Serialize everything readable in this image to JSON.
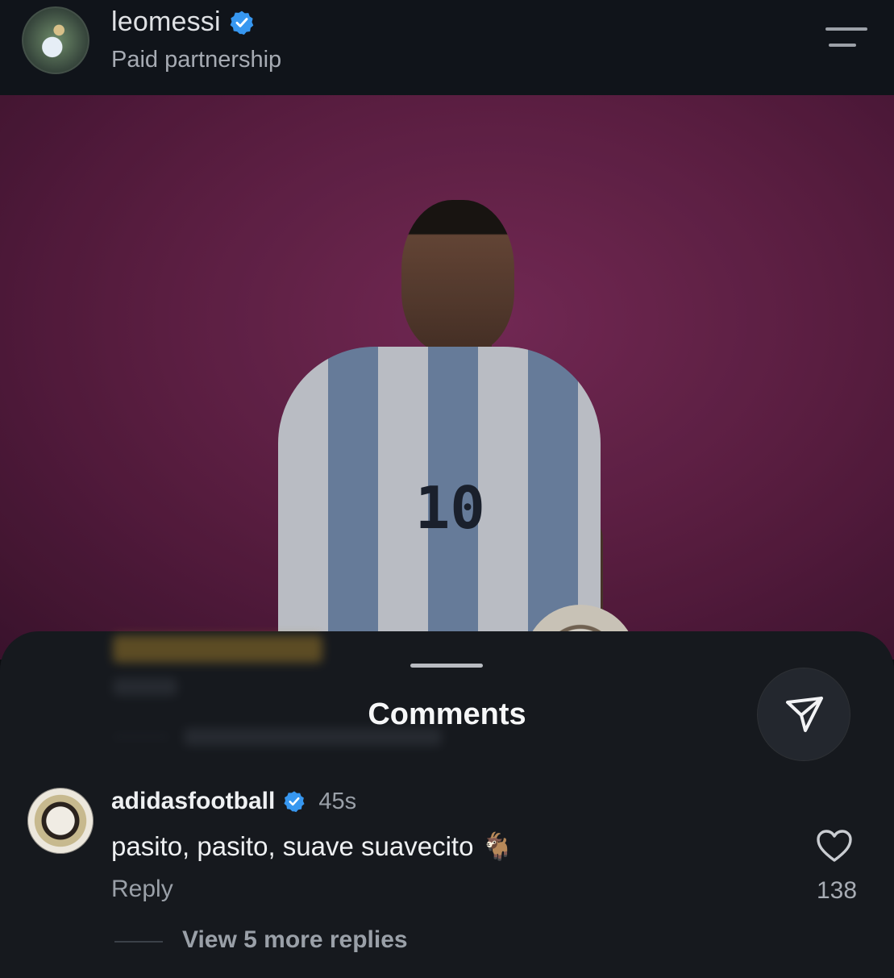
{
  "header": {
    "username": "leomessi",
    "subtitle": "Paid partnership",
    "avatar_icon": "profile-avatar",
    "menu_icon": "menu-icon"
  },
  "post": {
    "image_description_icon": "post-photo",
    "jersey_number": "10"
  },
  "comments": {
    "title": "Comments",
    "share_icon": "share-send-icon",
    "items": [
      {
        "username": "adidasfootball",
        "verified": true,
        "time": "45s",
        "text": "pasito, pasito, suave suavecito 🐐",
        "reply_label": "Reply",
        "likes": "138",
        "view_replies": "View 5 more replies"
      }
    ]
  },
  "colors": {
    "verified": "#3797f0",
    "background": "#16191e",
    "photo_bg": "#6a2350"
  }
}
